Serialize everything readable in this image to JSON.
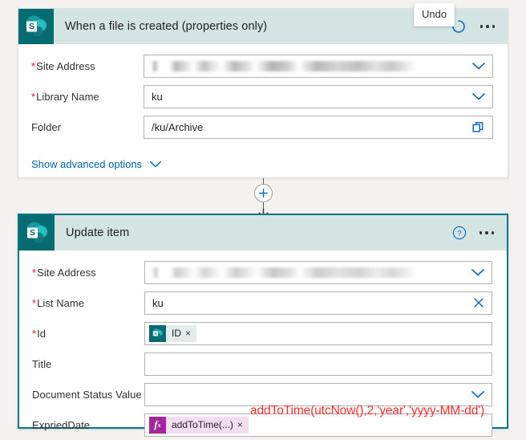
{
  "page": {
    "background": "#f3f2f1",
    "accent_teal": "#036c70",
    "link_blue": "#0063b1",
    "required_red": "#e81123",
    "annotation_red": "#ff2d2d",
    "expression_magenta": "#a4269a"
  },
  "tooltip": {
    "label": "Undo"
  },
  "connector": {
    "add_step_label": "+"
  },
  "cards": [
    {
      "title": "When a file is created (properties only)",
      "connector_icon": "sharepoint-icon",
      "selected": false,
      "header_actions": [
        "undo-icon",
        "more-options-icon"
      ],
      "fields": [
        {
          "label": "Site Address",
          "required": true,
          "value": "",
          "redacted": true,
          "control": "dropdown",
          "trailing_icon": "chevron-down-icon"
        },
        {
          "label": "Library Name",
          "required": true,
          "value": "ku",
          "redacted": false,
          "control": "dropdown",
          "trailing_icon": "chevron-down-icon"
        },
        {
          "label": "Folder",
          "required": false,
          "value": "/ku/Archive",
          "redacted": false,
          "control": "picker",
          "trailing_icon": "folder-picker-icon"
        }
      ],
      "advanced_options": {
        "label": "Show advanced options",
        "icon": "chevron-down-icon"
      }
    },
    {
      "title": "Update item",
      "connector_icon": "sharepoint-icon",
      "selected": true,
      "header_actions": [
        "help-icon",
        "more-options-icon"
      ],
      "fields": [
        {
          "label": "Site Address",
          "required": true,
          "value": "",
          "redacted": true,
          "control": "dropdown",
          "trailing_icon": "chevron-down-icon"
        },
        {
          "label": "List Name",
          "required": true,
          "value": "ku",
          "redacted": false,
          "control": "clearable",
          "trailing_icon": "clear-icon"
        },
        {
          "label": "Id",
          "required": true,
          "value": "",
          "redacted": false,
          "control": "token",
          "token": {
            "type": "dynamic-content",
            "icon": "sharepoint-icon",
            "label": "ID",
            "remove": "×"
          }
        },
        {
          "label": "Title",
          "required": false,
          "value": "",
          "redacted": false,
          "control": "text",
          "trailing_icon": ""
        },
        {
          "label": "Document Status Value",
          "required": false,
          "value": "",
          "redacted": false,
          "control": "dropdown",
          "trailing_icon": "chevron-down-icon"
        },
        {
          "label": "ExpriedDate",
          "required": false,
          "value": "",
          "redacted": false,
          "control": "expression-token",
          "token": {
            "type": "expression",
            "icon": "fx-icon",
            "label": "addToTime(...)",
            "remove": "×"
          },
          "annotation": "addToTime(utcNow(),2,'year','yyyy-MM-dd')"
        }
      ]
    }
  ]
}
